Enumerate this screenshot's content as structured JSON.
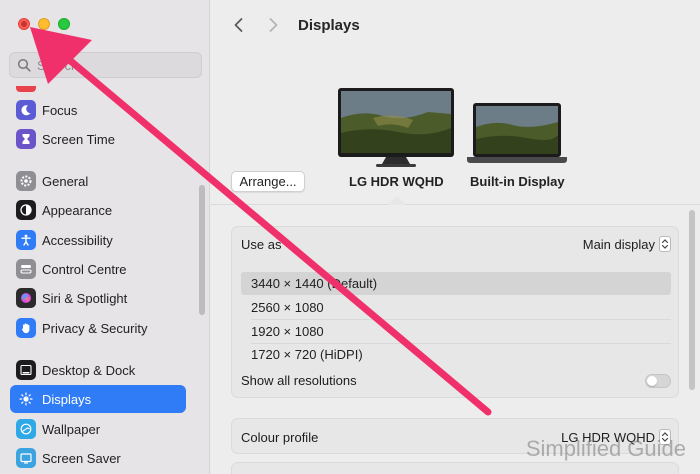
{
  "sidebar": {
    "search_placeholder": "Search",
    "items": [
      {
        "label": "Focus",
        "icon": "moon-icon",
        "color": "#5b5bd6"
      },
      {
        "label": "Screen Time",
        "icon": "hourglass-icon",
        "color": "#6b54c9"
      },
      {
        "label": "General",
        "icon": "gear-icon",
        "color": "#8e8e93"
      },
      {
        "label": "Appearance",
        "icon": "appearance-icon",
        "color": "#1c1c1e"
      },
      {
        "label": "Accessibility",
        "icon": "accessibility-icon",
        "color": "#2f7cf6"
      },
      {
        "label": "Control Centre",
        "icon": "control-centre-icon",
        "color": "#8e8e93"
      },
      {
        "label": "Siri & Spotlight",
        "icon": "siri-icon",
        "color": "#2b2b2b"
      },
      {
        "label": "Privacy & Security",
        "icon": "hand-icon",
        "color": "#2f7cf6"
      },
      {
        "label": "Desktop & Dock",
        "icon": "dock-icon",
        "color": "#1c1c1e"
      },
      {
        "label": "Displays",
        "icon": "sun-icon",
        "color": "#2f7cf6"
      },
      {
        "label": "Wallpaper",
        "icon": "wallpaper-icon",
        "color": "#2ea8e6"
      },
      {
        "label": "Screen Saver",
        "icon": "screen-saver-icon",
        "color": "#3aa3e0"
      }
    ]
  },
  "header": {
    "title": "Displays"
  },
  "displays": {
    "arrange_label": "Arrange...",
    "external": "LG HDR WQHD",
    "builtin": "Built-in Display"
  },
  "panel": {
    "use_as_label": "Use as",
    "use_as_value": "Main display",
    "resolutions": [
      "3440 × 1440 (Default)",
      "2560 × 1080",
      "1920 × 1080",
      "1720 × 720 (HiDPI)"
    ],
    "show_all_label": "Show all resolutions"
  },
  "colour": {
    "label": "Colour profile",
    "value": "LG HDR WQHD"
  },
  "watermark": "Simplified Guide",
  "colors": {
    "accent": "#2f7cf6",
    "arrow": "#f0306a"
  }
}
